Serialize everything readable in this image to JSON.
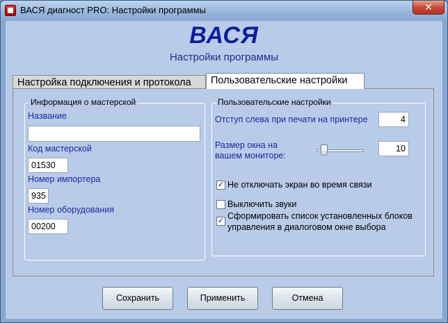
{
  "window": {
    "title": "ВАСЯ диагност PRO:  Настройки программы",
    "close_glyph": "✕"
  },
  "header": {
    "brand": "ВАСЯ",
    "subtitle": "Настройки программы"
  },
  "tabs": [
    {
      "label": "Настройка подключения и протокола",
      "active": false
    },
    {
      "label": "Пользовательские настройки",
      "active": true
    }
  ],
  "workshop_group": {
    "legend": "Информация о мастерской",
    "name_label": "Название",
    "name_value": "",
    "code_label": "Код мастерской",
    "code_value": "01530",
    "importer_label": "Номер импортера",
    "importer_value": "935",
    "equipment_label": "Номер оборудования",
    "equipment_value": "00200"
  },
  "user_group": {
    "legend": "Пользовательские настройки",
    "print_offset_label": "Отступ слева при печати на принтере",
    "print_offset_value": "4",
    "window_size_label_line1": "Размер окна на",
    "window_size_label_line2": "вашем мониторе:",
    "window_size_value": "10",
    "checkbox_screen": {
      "label": "Не отключать экран во время связи",
      "checked": true
    },
    "checkbox_sounds": {
      "label": "Выключить звуки",
      "checked": false
    },
    "checkbox_list": {
      "label_line1": "Сформировать список установленных блоков",
      "label_line2": "управления в диалоговом окне выбора",
      "checked": true
    },
    "check_glyph": "✓"
  },
  "buttons": {
    "save": "Сохранить",
    "apply": "Применить",
    "cancel": "Отмена"
  },
  "colors": {
    "brand": "#0b1f9c",
    "client_bg": "#b8cbe9",
    "label_blue": "#1a2aa0"
  }
}
